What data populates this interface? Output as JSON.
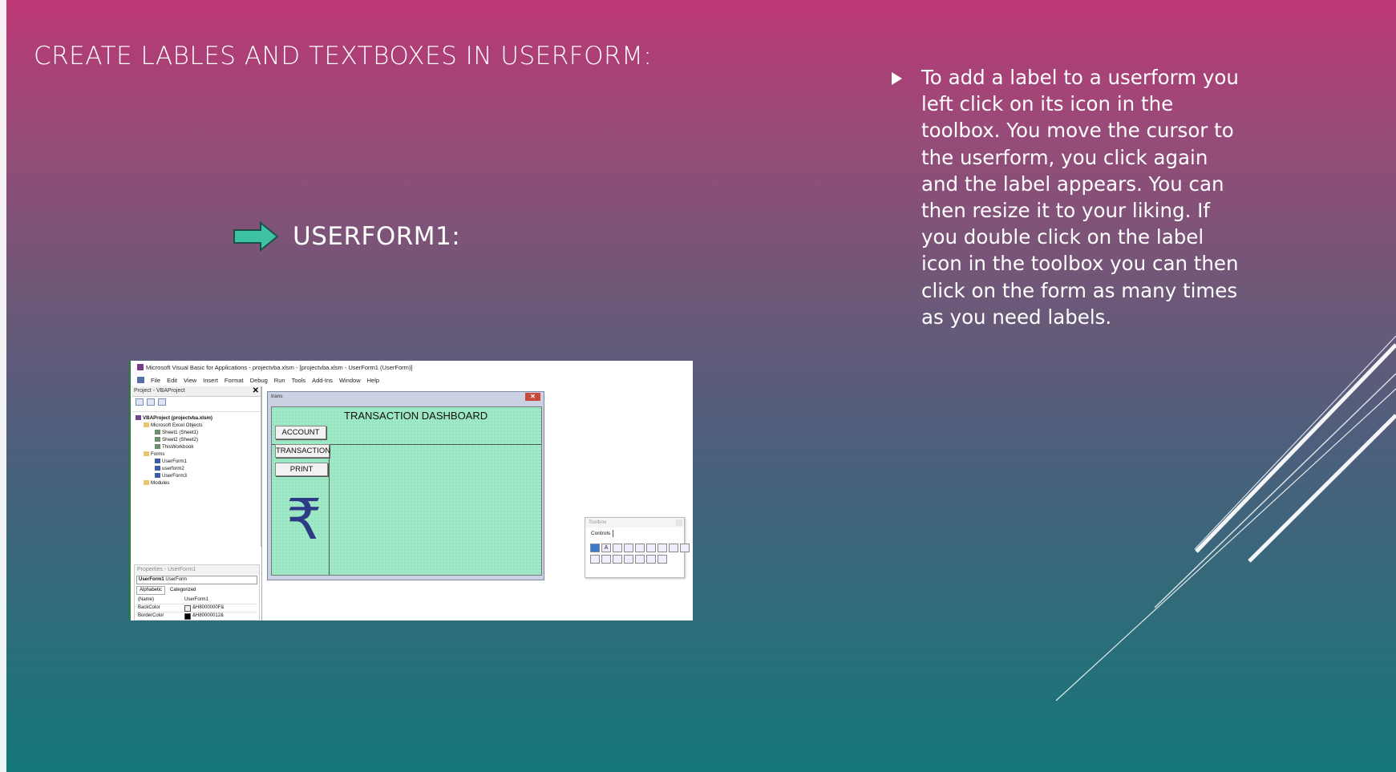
{
  "slide": {
    "title": "CREATE LABLES AND TEXTBOXES IN USERFORM:",
    "subheading": "USERFORM1:",
    "bullet_text": "To add a label to a userform you left click on its icon in the toolbox. You move the cursor to the userform, you click again and the label appears. You can then resize it to your liking. If you double click on the label icon in the toolbox you can then click on the form as many times as you need labels.",
    "arrow_color": "#3ec2a4",
    "accent_gradient": [
      "#bc3774",
      "#14777a"
    ]
  },
  "vba": {
    "title": "Microsoft Visual Basic for Applications - projectvba.xlsm - [projectvba.xlsm - UserForm1 (UserForm)]",
    "menu": [
      "File",
      "Edit",
      "View",
      "Insert",
      "Format",
      "Debug",
      "Run",
      "Tools",
      "Add-Ins",
      "Window",
      "Help"
    ],
    "project_panel": {
      "title": "Project - VBAProject",
      "tree": [
        {
          "label": "VBAProject (projectvba.xlsm)",
          "icon": "project-icon"
        },
        {
          "label": "Microsoft Excel Objects",
          "icon": "folder-icon"
        },
        {
          "label": "Sheet1 (Sheet1)",
          "icon": "sheet-icon"
        },
        {
          "label": "Sheet2 (Sheet2)",
          "icon": "sheet-icon"
        },
        {
          "label": "ThisWorkbook",
          "icon": "sheet-icon"
        },
        {
          "label": "Forms",
          "icon": "folder-icon"
        },
        {
          "label": "UserForm1",
          "icon": "form-icon"
        },
        {
          "label": "userform2",
          "icon": "form-icon"
        },
        {
          "label": "UserForm3",
          "icon": "form-icon"
        },
        {
          "label": "Modules",
          "icon": "folder-icon"
        }
      ]
    },
    "properties": {
      "title": "Properties - UserForm1",
      "object_bold": "UserForm1",
      "object_type": "UserForm",
      "tabs": [
        "Alphabetic",
        "Categorized"
      ],
      "rows": [
        {
          "key": "(Name)",
          "value": "UserForm1"
        },
        {
          "key": "BackColor",
          "value": "&H8000000F&"
        },
        {
          "key": "BorderColor",
          "value": "&H80000012&"
        }
      ]
    },
    "userform": {
      "caption": "trans",
      "close_glyph": "✕",
      "heading": "TRANSACTION DASHBOARD",
      "buttons": [
        "ACCOUNT",
        "TRANSACTION",
        "PRINT"
      ],
      "symbol": "₹",
      "body_color": "#9ee9c6"
    },
    "toolbox": {
      "title": "Toolbox",
      "tab": "Controls",
      "tools": [
        "pointer-icon",
        "label-icon",
        "textbox-icon",
        "combobox-icon",
        "listbox-icon",
        "checkbox-icon",
        "optionbutton-icon",
        "togglebutton-icon",
        "frame-icon",
        "commandbutton-icon",
        "tabstrip-icon",
        "multipage-icon",
        "scrollbar-icon",
        "spinbutton-icon",
        "image-icon",
        "refedit-icon"
      ],
      "label_glyph": "A"
    }
  }
}
